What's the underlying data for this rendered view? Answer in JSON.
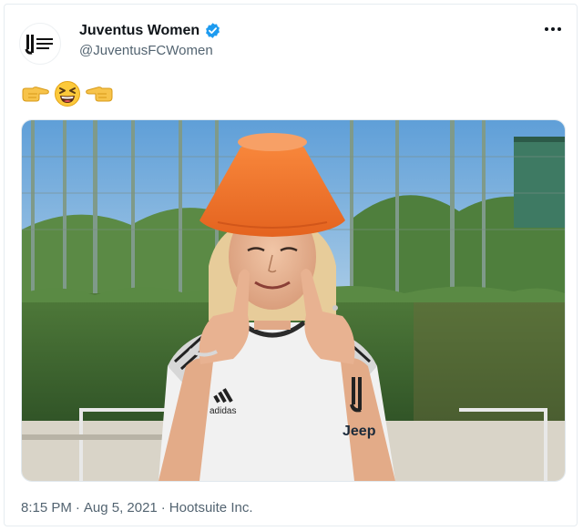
{
  "account": {
    "display_name": "Juventus Women",
    "handle": "@JuventusFCWomen",
    "verified": true,
    "avatar_logo_text_top": "JUVENTUS",
    "avatar_logo_text_bottom": "WOMEN"
  },
  "tweet": {
    "emojis": [
      "backhand-index-pointing-right",
      "grinning-squinting-face",
      "backhand-index-pointing-left"
    ]
  },
  "media": {
    "shirt_sponsor": "Jeep",
    "kit_brand": "adidas"
  },
  "meta": {
    "time": "8:15 PM",
    "date": "Aug 5, 2021",
    "source": "Hootsuite Inc.",
    "separator": "·"
  },
  "colors": {
    "verified_blue": "#1d9bf0",
    "secondary_text": "#536471",
    "primary_text": "#0f1419",
    "cone_orange": "#f27a2c"
  }
}
